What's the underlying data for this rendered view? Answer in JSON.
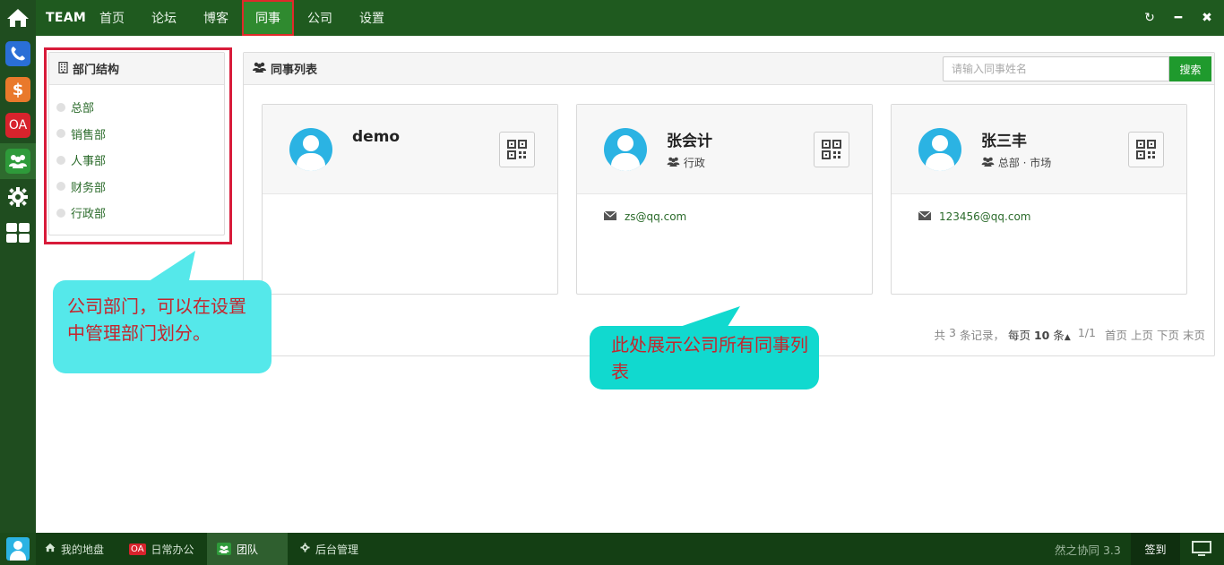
{
  "topbar": {
    "brand": "TEAM",
    "nav": [
      {
        "label": "首页"
      },
      {
        "label": "论坛"
      },
      {
        "label": "博客"
      },
      {
        "label": "同事",
        "active": true
      },
      {
        "label": "公司"
      },
      {
        "label": "设置"
      }
    ],
    "controls": [
      "refresh-icon",
      "minimize-icon",
      "close-icon"
    ]
  },
  "rail": {
    "items": [
      "home-icon",
      "phone-icon",
      "dollar-icon",
      "oa-icon",
      "team-icon",
      "gear-icon",
      "grid-icon"
    ],
    "oa_label": "OA",
    "dollar_label": "$"
  },
  "dept": {
    "title": "部门结构",
    "items": [
      "总部",
      "销售部",
      "人事部",
      "财务部",
      "行政部"
    ]
  },
  "colleagues": {
    "title": "同事列表",
    "search_placeholder": "请输入同事姓名",
    "search_button": "搜索",
    "cards": [
      {
        "name": "demo",
        "dept": "",
        "email": ""
      },
      {
        "name": "张会计",
        "dept": "行政",
        "email": "zs@qq.com"
      },
      {
        "name": "张三丰",
        "dept": "总部 · 市场",
        "email": "123456@qq.com"
      }
    ]
  },
  "pager": {
    "total_prefix": "共",
    "total": "3",
    "total_suffix": "条记录，",
    "per_page_prefix": "每页",
    "per_page": "10",
    "per_page_suffix": "条",
    "page_info": "1/1",
    "first": "首页",
    "prev": "上页",
    "next": "下页",
    "last": "末页"
  },
  "callouts": {
    "dept_note": "公司部门，可以在设置中管理部门划分。",
    "list_note": "此处展示公司所有同事列表"
  },
  "taskbar": {
    "items": [
      {
        "label": "我的地盘"
      },
      {
        "label": "日常办公"
      },
      {
        "label": "团队",
        "active": true
      },
      {
        "label": "后台管理"
      }
    ],
    "oa_badge": "OA",
    "version": "然之协同 3.3",
    "sign_in": "签到"
  },
  "colors": {
    "topbar": "#1f5a1f",
    "accent_green": "#1f9a2d",
    "highlight_red": "#d81b3a",
    "callout_cyan": "#55e8ea",
    "avatar_blue": "#2bb3e3"
  }
}
